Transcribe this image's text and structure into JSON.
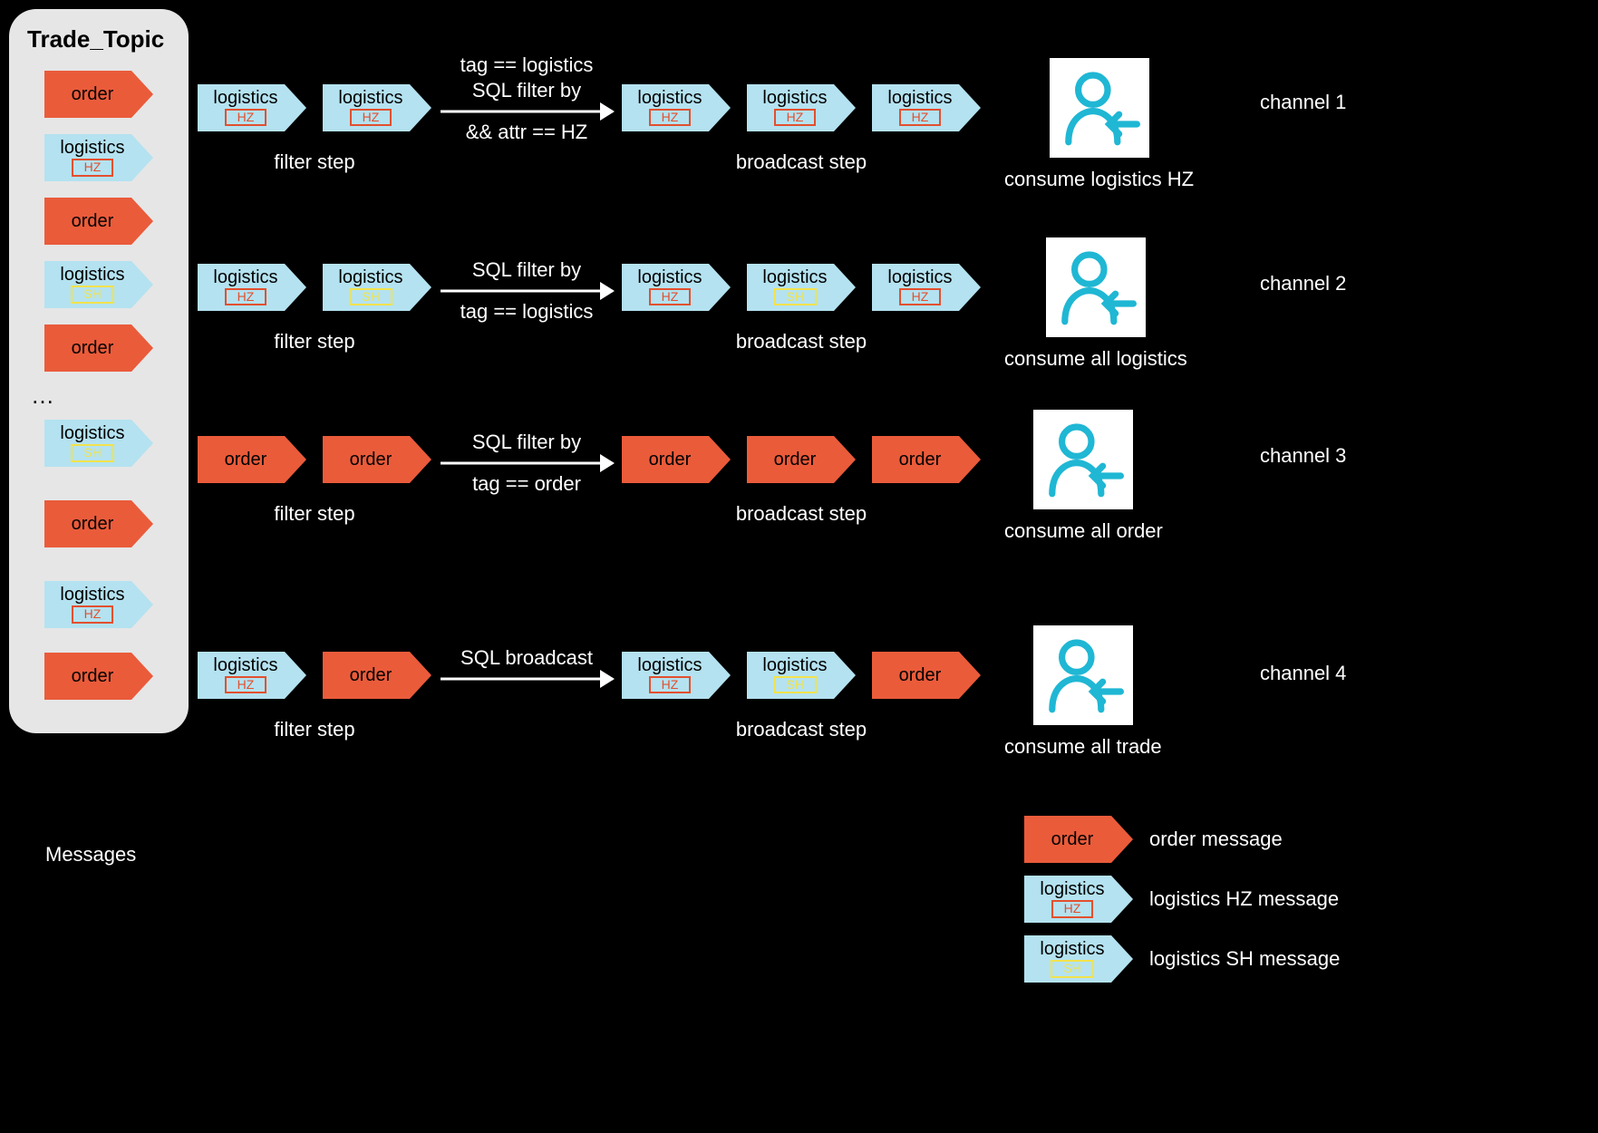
{
  "topic": {
    "title": "Trade_Topic",
    "ellipsis": "…"
  },
  "tags": {
    "order": "order",
    "logistics": "logistics",
    "hz": "HZ",
    "sh": "SH"
  },
  "captions": {
    "filter_step": "filter step",
    "broadcast_step": "broadcast step",
    "sql_filter_by": "SQL filter by",
    "sql_broadcast": "SQL broadcast",
    "tag_eq_logistics": "tag == logistics",
    "tag_eq_order": "tag == order",
    "attr_eq_hz": "&& attr == HZ",
    "ch1": "channel 1",
    "ch2": "channel 2",
    "ch3": "channel 3",
    "ch4": "channel 4",
    "consume_logistics_hz": "consume logistics HZ",
    "consume_logistics": "consume all logistics",
    "consume_order": "consume all order",
    "consume_trade": "consume all trade",
    "messages": "Messages",
    "order_msg": "order message",
    "logistics_hz_msg": "logistics HZ message",
    "logistics_sh_msg": "logistics SH message"
  }
}
